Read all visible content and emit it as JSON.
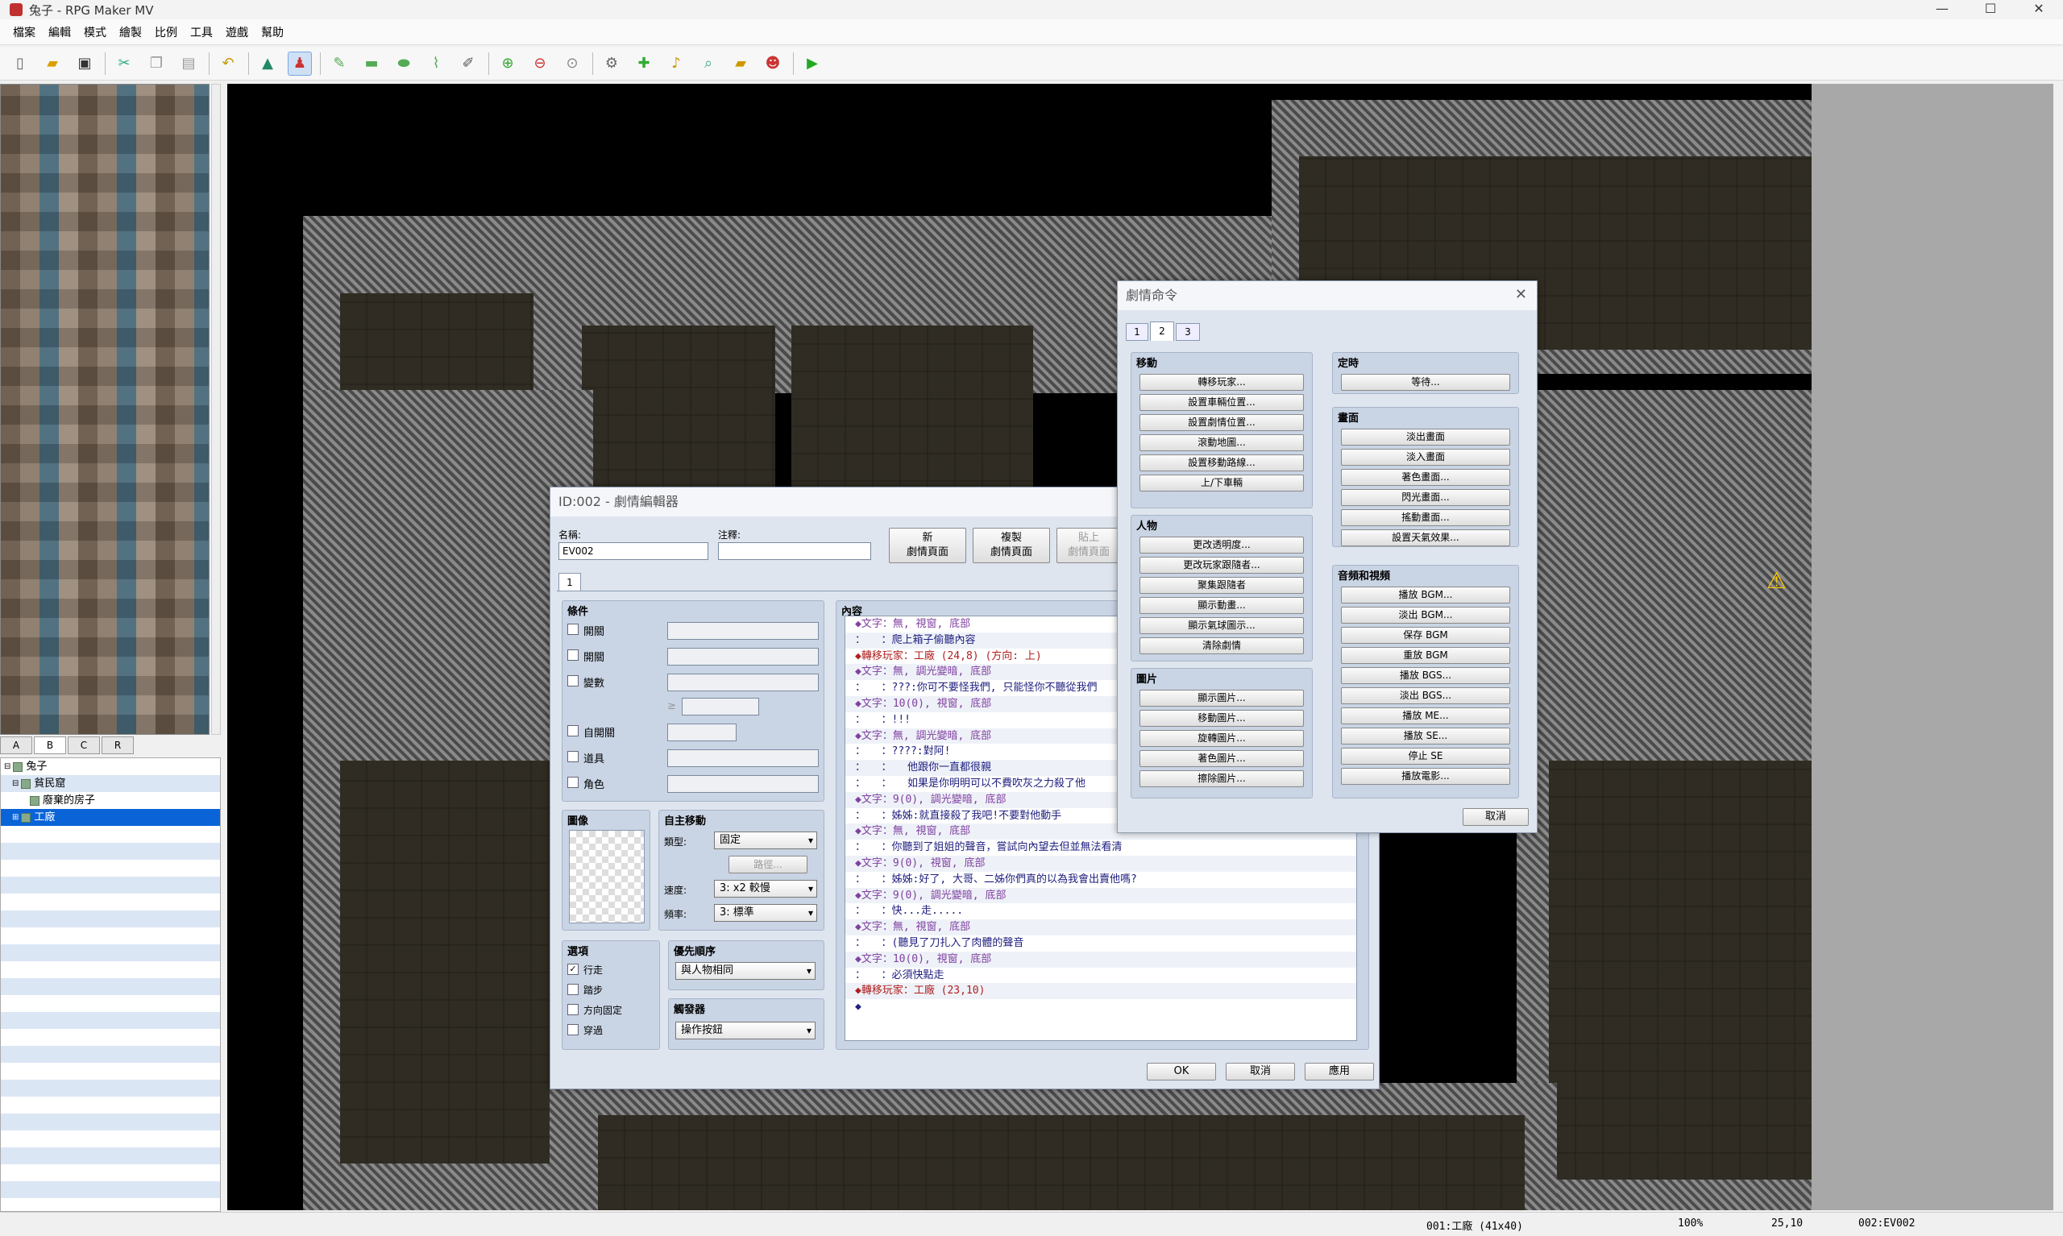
{
  "window": {
    "title": "兔子 - RPG Maker MV",
    "min": "—",
    "max": "☐",
    "close": "✕"
  },
  "menu": [
    "檔案",
    "編輯",
    "模式",
    "繪製",
    "比例",
    "工具",
    "遊戲",
    "幫助"
  ],
  "toolbar": {
    "icons": [
      "new-project",
      "open-project",
      "save-project",
      "cut",
      "copy",
      "paste",
      "undo",
      "map-mode",
      "event-mode",
      "pencil",
      "rectangle",
      "ellipse",
      "flood-fill",
      "shadow-pen",
      "zoom-in",
      "zoom-out",
      "zoom-actual",
      "database",
      "plugin-manager",
      "sound-test",
      "event-searcher",
      "resource-manager",
      "character-generator",
      "playtest"
    ]
  },
  "tileset_tabs": [
    "A",
    "B",
    "C",
    "R"
  ],
  "maptree": [
    {
      "label": "兔子",
      "level": 0,
      "selected": false
    },
    {
      "label": "貧民窟",
      "level": 1,
      "selected": false
    },
    {
      "label": "廢棄的房子",
      "level": 2,
      "selected": false
    },
    {
      "label": "工廠",
      "level": 1,
      "selected": true
    }
  ],
  "statusbar": {
    "map": "001:工廠 (41x40)",
    "zoom": "100%",
    "coords": "25,10",
    "event": "002:EV002"
  },
  "event_editor": {
    "title": "ID:002 - 劇情編輯器",
    "name_label": "名稱:",
    "name_value": "EV002",
    "note_label": "注釋:",
    "note_value": "",
    "btn_new": "新\n劇情頁面",
    "btn_copy": "複製\n劇情頁面",
    "btn_paste": "貼上\n劇情頁面",
    "page_tab": "1",
    "conditions_label": "條件",
    "cond_switch1": "開關",
    "cond_switch2": "開關",
    "cond_variable": "變數",
    "cond_ge": "≥",
    "cond_self_switch": "自開關",
    "cond_item": "道具",
    "cond_actor": "角色",
    "image_label": "圖像",
    "autonomous_label": "自主移動",
    "type_label": "類型:",
    "type_value": "固定",
    "route_btn": "路徑...",
    "speed_label": "速度:",
    "speed_value": "3: x2 較慢",
    "freq_label": "頻率:",
    "freq_value": "3: 標準",
    "options_label": "選項",
    "opt_walking": "行走",
    "opt_stepping": "踏步",
    "opt_dirfix": "方向固定",
    "opt_through": "穿過",
    "priority_label": "優先順序",
    "priority_value": "與人物相同",
    "trigger_label": "觸發器",
    "trigger_value": "操作按鈕",
    "contents_label": "內容",
    "ok": "OK",
    "cancel": "取消",
    "apply": "應用",
    "contents": [
      {
        "kind": "text",
        "t": "◆文字：無, 視窗, 底部"
      },
      {
        "kind": "body",
        "t": "：　　：爬上箱子偷聽內容"
      },
      {
        "kind": "xfer",
        "t": "◆轉移玩家：工廠 (24,8) (方向: 上)"
      },
      {
        "kind": "text",
        "t": "◆文字：無, 調光變暗, 底部"
      },
      {
        "kind": "body",
        "t": "：　　：???:你可不要怪我們, 只能怪你不聽從我們"
      },
      {
        "kind": "text",
        "t": "◆文字：10(0), 視窗, 底部"
      },
      {
        "kind": "body",
        "t": "：　　：!!!"
      },
      {
        "kind": "text",
        "t": "◆文字：無, 調光變暗, 底部"
      },
      {
        "kind": "body",
        "t": "：　　：????:對阿!"
      },
      {
        "kind": "body",
        "t": "：　　：　　他跟你一直都很親"
      },
      {
        "kind": "body",
        "t": "：　　：　　如果是你明明可以不費吹灰之力殺了他"
      },
      {
        "kind": "text",
        "t": "◆文字：9(0), 調光變暗, 底部"
      },
      {
        "kind": "body",
        "t": "：　　：姊姊:就直接殺了我吧!不要對他動手"
      },
      {
        "kind": "text",
        "t": "◆文字：無, 視窗, 底部"
      },
      {
        "kind": "body",
        "t": "：　　：你聽到了姐姐的聲音，嘗試向內望去但並無法看清"
      },
      {
        "kind": "text",
        "t": "◆文字：9(0), 視窗, 底部"
      },
      {
        "kind": "body",
        "t": "：　　：姊姊:好了, 大哥、二姊你們真的以為我會出賣他嗎?"
      },
      {
        "kind": "text",
        "t": "◆文字：9(0), 調光變暗, 底部"
      },
      {
        "kind": "body",
        "t": "：　　：快...走....."
      },
      {
        "kind": "text",
        "t": "◆文字：無, 視窗, 底部"
      },
      {
        "kind": "body",
        "t": "：　　：(聽見了刀扎入了肉體的聲音"
      },
      {
        "kind": "text",
        "t": "◆文字：10(0), 視窗, 底部"
      },
      {
        "kind": "body",
        "t": "：　　：必須快點走"
      },
      {
        "kind": "xfer",
        "t": "◆轉移玩家：工廠 (23,10)"
      },
      {
        "kind": "body",
        "t": "◆"
      }
    ]
  },
  "event_commands": {
    "title": "劇情命令",
    "tabs": [
      "1",
      "2",
      "3"
    ],
    "movement_label": "移動",
    "movement": [
      "轉移玩家...",
      "設置車輛位置...",
      "設置劇情位置...",
      "滾動地圖...",
      "設置移動路線...",
      "上/下車輛"
    ],
    "character_label": "人物",
    "character": [
      "更改透明度...",
      "更改玩家跟隨者...",
      "聚集跟隨者",
      "顯示動畫...",
      "顯示氣球圖示...",
      "清除劇情"
    ],
    "picture_label": "圖片",
    "picture": [
      "顯示圖片...",
      "移動圖片...",
      "旋轉圖片...",
      "著色圖片...",
      "擦除圖片..."
    ],
    "timing_label": "定時",
    "timing": [
      "等待..."
    ],
    "screen_label": "畫面",
    "screen": [
      "淡出畫面",
      "淡入畫面",
      "著色畫面...",
      "閃光畫面...",
      "搖動畫面...",
      "設置天氣效果..."
    ],
    "audio_label": "音頻和視頻",
    "audio": [
      "播放 BGM...",
      "淡出 BGM...",
      "保存 BGM",
      "重放 BGM",
      "播放 BGS...",
      "淡出 BGS...",
      "播放 ME...",
      "播放 SE...",
      "停止 SE",
      "播放電影..."
    ],
    "cancel": "取消",
    "close": "✕"
  },
  "colors": {
    "accent": "#0a64d8",
    "dialog_bg": "#dfe5ee",
    "group_bg": "#c9d4e4",
    "xfer_text": "#b02020",
    "cmd_text": "#8040a0"
  }
}
